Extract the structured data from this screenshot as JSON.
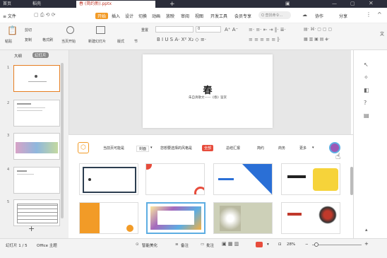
{
  "titlebar": {
    "tabs": [
      "首页",
      "稻壳",
      "春 (简约新).pptx"
    ],
    "plus": "+"
  },
  "menu": {
    "file": "≡ 文件",
    "items": [
      "开始",
      "插入",
      "设计",
      "切换",
      "动画",
      "放映",
      "审阅",
      "视图",
      "开发工具",
      "会员专享"
    ],
    "search": "Q 查找命令...",
    "cooperate": "协作",
    "share": "分享"
  },
  "toolbar": {
    "paste": "粘贴",
    "cut": "剪切",
    "copy": "复制",
    "format_painter": "格式刷",
    "play_from": "当页开始",
    "new_slide": "新建幻灯片",
    "layout": "版式",
    "section": "节",
    "reset": "重置",
    "font_size": "0"
  },
  "sidepanel": {
    "tab_outline": "大纲",
    "tab_slides": "幻灯片",
    "numbers": [
      "1",
      "2",
      "3",
      "4",
      "5"
    ],
    "add": "+"
  },
  "slide": {
    "title": "春",
    "subtitle": "朱自清散文——《春》鉴赏"
  },
  "template_panel": {
    "current_page": "当前页可能是",
    "page_type": "封面",
    "style_prompt": "您想要选择的风格是",
    "styles": [
      "全部",
      "总结汇报",
      "简约",
      "商务",
      "更多"
    ]
  },
  "statusbar": {
    "slide_info": "幻灯片 1 / 5",
    "theme": "Office 主题",
    "beautify": "智能美化",
    "notes": "备注",
    "comments": "批注",
    "zoom": "28%"
  },
  "colors": {
    "accent": "#f29b27",
    "selected_style": "#e74c3c"
  }
}
